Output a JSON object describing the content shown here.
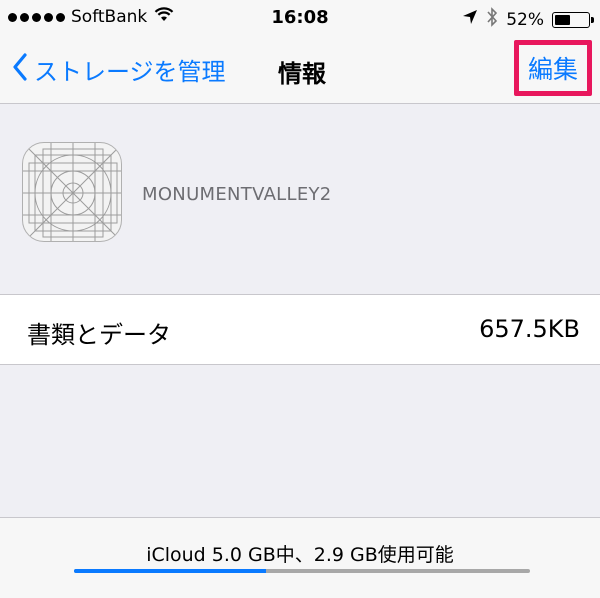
{
  "status_bar": {
    "carrier": "SoftBank",
    "time": "16:08",
    "battery_percent": "52%",
    "battery_level": 0.52
  },
  "nav": {
    "back_label": "ストレージを管理",
    "title": "情報",
    "edit_label": "編集",
    "highlight_color": "#e8175d",
    "accent_color": "#0a7aff"
  },
  "app": {
    "name": "MONUMENTVALLEY2",
    "icon": "app-placeholder-icon"
  },
  "documents_row": {
    "label": "書類とデータ",
    "value": "657.5KB"
  },
  "storage": {
    "text": "iCloud 5.0 GB中、2.9 GB使用可能",
    "used_fraction": 0.42
  }
}
